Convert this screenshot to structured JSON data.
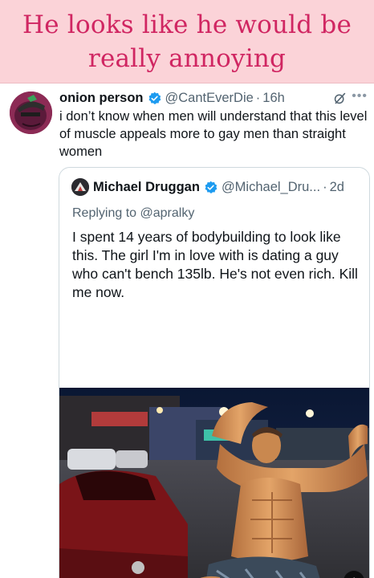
{
  "caption": {
    "line1": "He looks like he would be",
    "line2": "really annoying"
  },
  "tweet": {
    "author_name": "onion person",
    "handle": "@CantEverDie",
    "separator": "·",
    "time": "16h",
    "text": "i don’t know when men will understand that this level of muscle appeals more to gay men than straight women",
    "icons": [
      "verified-badge-icon",
      "grok-icon",
      "more-icon"
    ]
  },
  "quote": {
    "author_name": "Michael Druggan",
    "handle": "@Michael_Dru...",
    "separator": "·",
    "time": "2d",
    "replying_prefix": "Replying to ",
    "replying_handle": "@apralky",
    "text": "I spent 14 years of bodybuilding to look like this. The girl I'm in love with is dating a guy who can't bench 135lb. He's not even rich. Kill me now.",
    "icons": [
      "verified-badge-icon",
      "mute-icon"
    ]
  },
  "colors": {
    "caption_bg": "#fbd3d8",
    "caption_text": "#d02662",
    "verified_blue": "#1d9bf0",
    "secondary_text": "#536471"
  }
}
